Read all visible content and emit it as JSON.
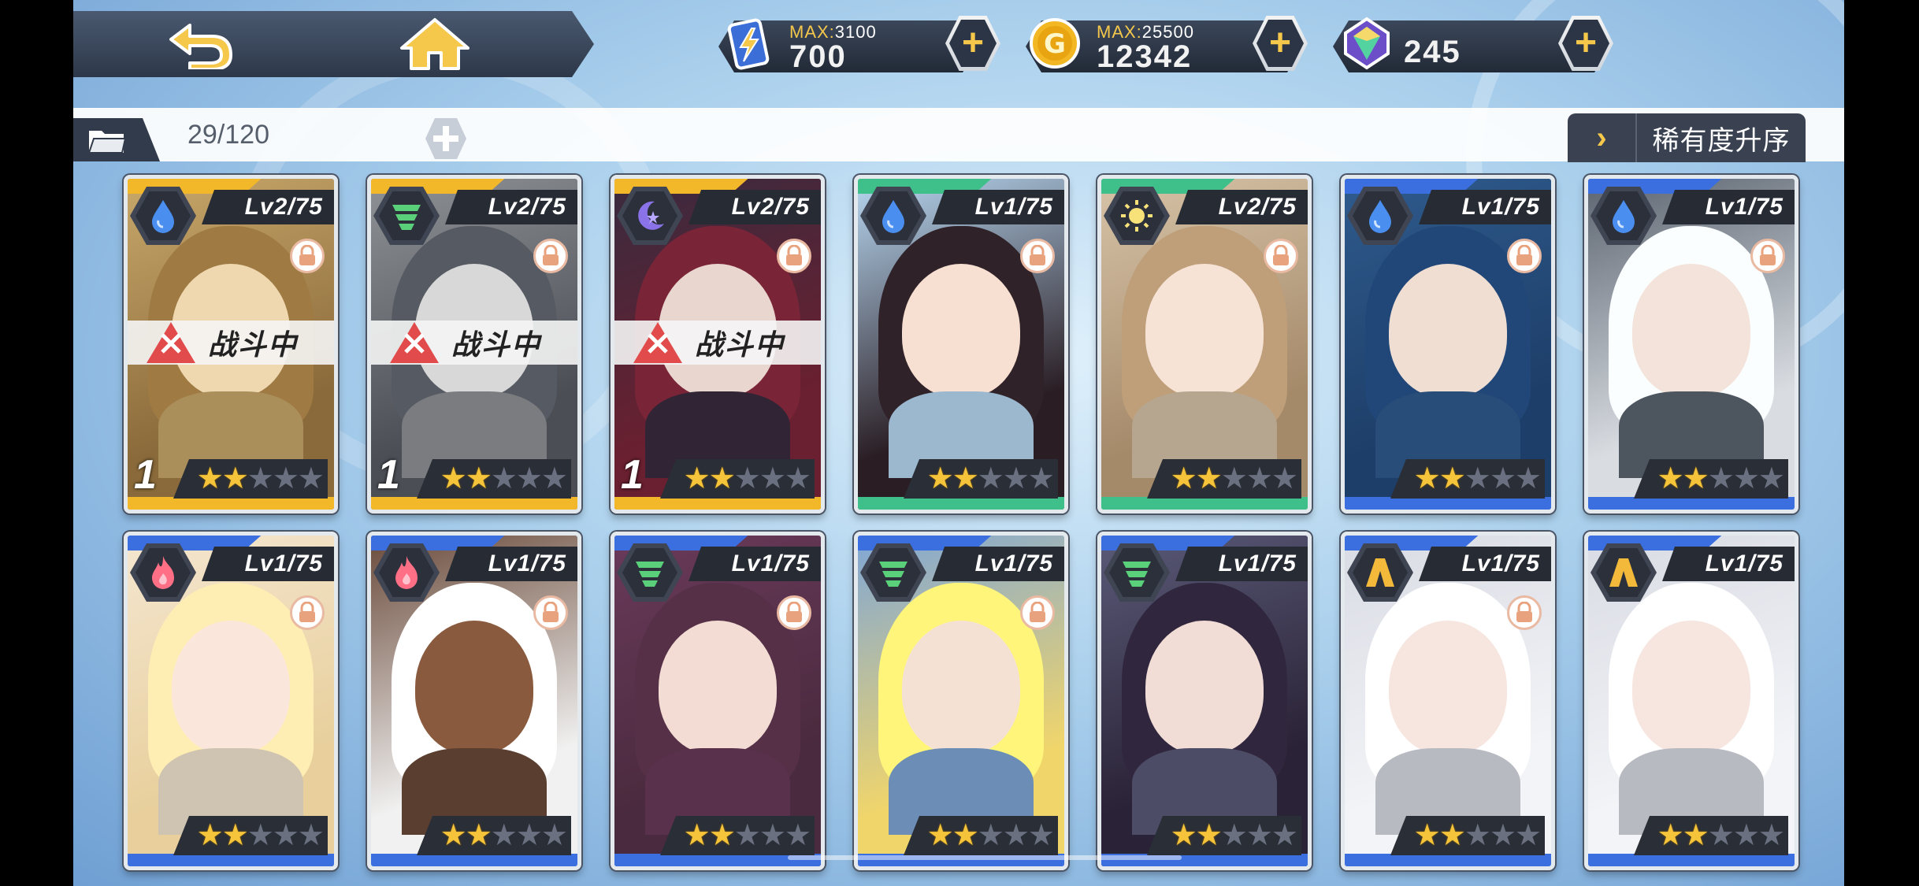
{
  "top_bar": {
    "back_icon": "back-arrow-icon",
    "home_icon": "home-icon",
    "resources": [
      {
        "name": "stamina",
        "icon": "battery-bolt-icon",
        "max_prefix": "MAX:",
        "max_value": "3100",
        "value": "700"
      },
      {
        "name": "gold",
        "icon": "gold-coin-icon",
        "max_prefix": "MAX:",
        "max_value": "25500",
        "value": "12342"
      },
      {
        "name": "gems",
        "icon": "crystal-icon",
        "value": "245"
      }
    ],
    "plus_label": "+"
  },
  "inventory_bar": {
    "count": "29/120",
    "sort_label": "稀有度升序",
    "sort_chevron": "›"
  },
  "battle_label": "战斗中",
  "cards": [
    {
      "level": "Lv2/75",
      "attribute": "water",
      "rarity": "gold",
      "in_battle": true,
      "party": "1",
      "stars": 2,
      "stars_max": 5,
      "locked": true
    },
    {
      "level": "Lv2/75",
      "attribute": "wind",
      "rarity": "gold",
      "in_battle": true,
      "party": "1",
      "stars": 2,
      "stars_max": 5,
      "locked": true
    },
    {
      "level": "Lv2/75",
      "attribute": "dark",
      "rarity": "gold",
      "in_battle": true,
      "party": "1",
      "stars": 2,
      "stars_max": 5,
      "locked": true
    },
    {
      "level": "Lv1/75",
      "attribute": "water",
      "rarity": "green",
      "in_battle": false,
      "stars": 2,
      "stars_max": 5,
      "locked": true
    },
    {
      "level": "Lv2/75",
      "attribute": "light",
      "rarity": "green",
      "in_battle": false,
      "stars": 2,
      "stars_max": 5,
      "locked": true
    },
    {
      "level": "Lv1/75",
      "attribute": "water",
      "rarity": "blue",
      "in_battle": false,
      "stars": 2,
      "stars_max": 5,
      "locked": true
    },
    {
      "level": "Lv1/75",
      "attribute": "water",
      "rarity": "blue",
      "in_battle": false,
      "stars": 2,
      "stars_max": 5,
      "locked": true
    },
    {
      "level": "Lv1/75",
      "attribute": "fire",
      "rarity": "blue",
      "in_battle": false,
      "stars": 2,
      "stars_max": 5,
      "locked": true
    },
    {
      "level": "Lv1/75",
      "attribute": "fire",
      "rarity": "blue",
      "in_battle": false,
      "stars": 2,
      "stars_max": 5,
      "locked": true
    },
    {
      "level": "Lv1/75",
      "attribute": "wind",
      "rarity": "blue",
      "in_battle": false,
      "stars": 2,
      "stars_max": 5,
      "locked": true
    },
    {
      "level": "Lv1/75",
      "attribute": "wind",
      "rarity": "blue",
      "in_battle": false,
      "stars": 2,
      "stars_max": 5,
      "locked": true
    },
    {
      "level": "Lv1/75",
      "attribute": "wind",
      "rarity": "blue",
      "in_battle": false,
      "stars": 2,
      "stars_max": 5,
      "locked": false
    },
    {
      "level": "Lv1/75",
      "attribute": "earth",
      "rarity": "blue",
      "in_battle": false,
      "stars": 2,
      "stars_max": 5,
      "locked": true
    },
    {
      "level": "Lv1/75",
      "attribute": "earth",
      "rarity": "blue",
      "in_battle": false,
      "stars": 2,
      "stars_max": 5,
      "locked": false
    }
  ],
  "colors": {
    "accent_gold": "#f5c84b",
    "rarity_gold": "#f3b72a",
    "rarity_green": "#3fc08a",
    "rarity_blue": "#3b6fe0",
    "panel_dark": "#2b3240"
  }
}
